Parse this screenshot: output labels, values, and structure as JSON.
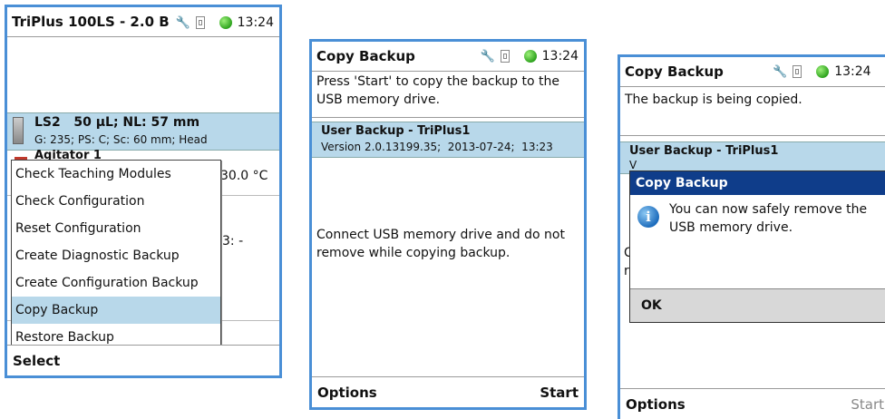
{
  "colors": {
    "frame": "#4a8fd6",
    "highlight": "#b8d8ea",
    "dialog_header": "#0f3d8a",
    "status_led": "#2ea31e"
  },
  "screen1": {
    "title": "TriPlus 100LS - 2.0 B",
    "time": "13:24",
    "device_row": {
      "line1": "LS2   50 µL; NL: 57 mm",
      "line2": "G: 235; PS: C; Sc: 60 mm; Head"
    },
    "agitator": {
      "label": "Agitator 1",
      "temp": "30.0 °C"
    },
    "bg_fragment": "3: -",
    "menu": [
      "Check Teaching Modules",
      "Check Configuration",
      "Reset Configuration",
      "Create Diagnostic Backup",
      "Create Configuration Backup",
      "Copy Backup",
      "Restore Backup"
    ],
    "softkey_left": "Select"
  },
  "screen2": {
    "title": "Copy Backup",
    "time": "13:24",
    "instruction": "Press 'Start' to copy the backup to the USB memory drive.",
    "backup_name": "User Backup - TriPlus1",
    "backup_version": "Version 2.0.13199.35;  2013-07-24;  13:23",
    "message": "Connect USB memory drive and do not remove while copying backup.",
    "softkey_left": "Options",
    "softkey_right": "Start"
  },
  "screen3": {
    "title": "Copy Backup",
    "time": "13:24",
    "status": "The backup is being copied.",
    "backup_name": "User Backup - TriPlus1",
    "backup_version_partial": "V",
    "left_fragment_1": "C",
    "left_fragment_2": "r",
    "dialog": {
      "title": "Copy Backup",
      "message": "You can now safely remove the USB memory drive.",
      "ok": "OK"
    },
    "softkey_left": "Options",
    "softkey_right": "Start"
  }
}
